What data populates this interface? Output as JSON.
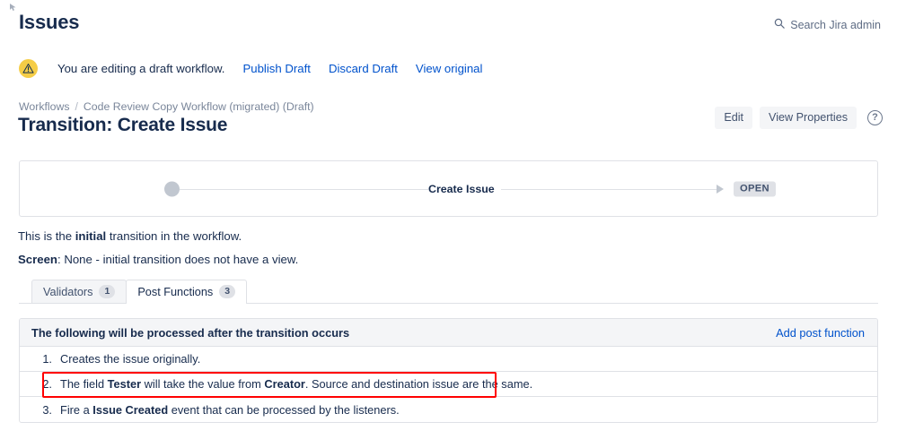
{
  "header": {
    "title": "Issues",
    "search_label": "Search Jira admin",
    "search_icon": "search-icon"
  },
  "draft_banner": {
    "icon": "warning-icon",
    "message": "You are editing a draft workflow.",
    "links": [
      {
        "label": "Publish Draft"
      },
      {
        "label": "Discard Draft"
      },
      {
        "label": "View original"
      }
    ]
  },
  "breadcrumb": {
    "root": "Workflows",
    "separator": "/",
    "current": "Code Review Copy Workflow (migrated) (Draft)"
  },
  "page": {
    "transition_title": "Transition: Create Issue"
  },
  "header_actions": {
    "edit_label": "Edit",
    "view_properties_label": "View Properties",
    "help_icon": "question-circle-icon",
    "help_glyph": "?"
  },
  "diagram": {
    "edge_label": "Create Issue",
    "target_status": "OPEN",
    "start_node": "initial-state-dot"
  },
  "info": {
    "line1_prefix": "This is the ",
    "line1_bold": "initial",
    "line1_suffix": " transition in the workflow.",
    "line2_bold": "Screen",
    "line2_text": ": None - initial transition does not have a view."
  },
  "tabs": [
    {
      "label": "Validators",
      "count": "1",
      "active": false
    },
    {
      "label": "Post Functions",
      "count": "3",
      "active": true
    }
  ],
  "post_functions": {
    "header_title": "The following will be processed after the transition occurs",
    "add_link": "Add post function",
    "rows": [
      {
        "num": "1.",
        "pre": "Creates the issue originally.",
        "bold1": "",
        "mid": "",
        "bold2": "",
        "post": "",
        "highlighted": false
      },
      {
        "num": "2.",
        "pre": "The field ",
        "bold1": "Tester",
        "mid": " will take the value from ",
        "bold2": "Creator",
        "post": ". Source and destination issue are the same.",
        "highlighted": true
      },
      {
        "num": "3.",
        "pre": "Fire a ",
        "bold1": "Issue Created",
        "mid": " event that can be processed by the listeners.",
        "bold2": "",
        "post": "",
        "highlighted": false
      }
    ]
  },
  "colors": {
    "link": "#0052CC",
    "text": "#172B4D",
    "subtle": "#7A869A",
    "border": "#DFE1E6",
    "panel_bg": "#F4F5F7",
    "warning": "#F5CD47",
    "annotation": "#FF0000"
  }
}
